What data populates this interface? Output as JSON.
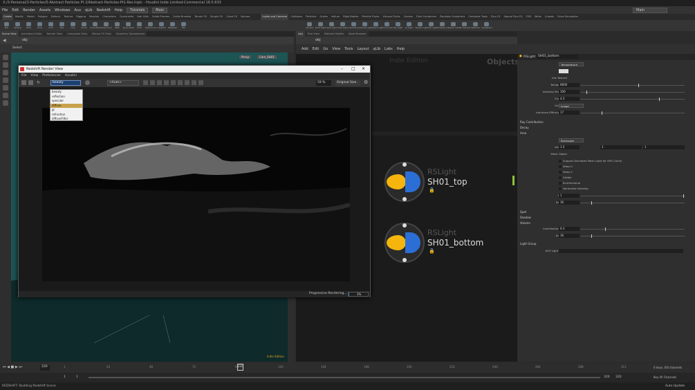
{
  "titlebar": "X:/3-Personal/3-Particles/5-Abstract Particles Pt 2/Abstract-Particles-Pt1-Res.hiplc - Houdini Indie Limited-Commercial 18.5.633",
  "menubar": {
    "items": [
      "File",
      "Edit",
      "Render",
      "Assets",
      "Windows",
      "Aux",
      "qLib",
      "Redshift",
      "Help"
    ],
    "desktop": "Tutorials",
    "context": "Main",
    "right_drop": "Main"
  },
  "shelf_tabs_left": [
    "Create",
    "Modify",
    "Model",
    "Polygon",
    "Deform",
    "Texture",
    "Rigging",
    "Muscles",
    "Characters",
    "Constraints",
    "Hair Utils",
    "Guide Process",
    "Guide Brushes",
    "Terrain FX",
    "Simple FX",
    "Cloud FX",
    "Volume"
  ],
  "shelf_tabs_right": [
    "Lights and Cameras",
    "Collisions",
    "Particles",
    "Grains",
    "Vellum",
    "Rigid Bodies",
    "Particle Fluids",
    "Viscous Fluids",
    "Oceans",
    "Fluid Containers",
    "Populate Containers",
    "Container Tools",
    "Pyro FX",
    "Sparse Pyro FX",
    "FEM",
    "Wires",
    "Crowds",
    "Drive Simulation"
  ],
  "shelf_tools_left": [
    "Box",
    "Sphere",
    "Tube",
    "Torus",
    "Grid",
    "Null",
    "Line",
    "Circle",
    "Curve Bezier",
    "Draw Curve",
    "Path",
    "Spray Paint",
    "Font",
    "Platonic Solids",
    "L-System",
    "Metaball",
    "File"
  ],
  "shelf_tools_right": [
    "Camera",
    "Point Light",
    "Spot Light",
    "Area Light",
    "Geometry Light",
    "Volume Light",
    "Distant Light",
    "Environment Light",
    "Sky Light",
    "GI Light",
    "Caustic Light",
    "Portal Light",
    "Ambient Light",
    "Stereo Camera",
    "VR Camera",
    "Switcher",
    "Gamepad Camera"
  ],
  "pane_tabs_left": [
    "Scene View",
    "Animation Editor",
    "Render View",
    "Composite View",
    "Motion FX View",
    "Geometry Spreadsheet"
  ],
  "pane_tabs_right": [
    "/obj",
    "Tree View",
    "Material Palette",
    "Asset Browser"
  ],
  "viewport": {
    "path": "obj",
    "mode": "Select",
    "persp": "Persp",
    "cam": "Cam_SH01",
    "badge": "Indie Edition"
  },
  "render_view": {
    "title": "Redshift Render View",
    "menu": [
      "File",
      "View",
      "Preferences",
      "Houdini"
    ],
    "aov_selected": "beauty",
    "aov_options": [
      "beauty",
      "reflection",
      "specular",
      "diffuse",
      "gi",
      "refraction",
      "diffuseFilter"
    ],
    "aov_highlight": "diffuse",
    "camera": "<Auto>",
    "zoom": "59 %",
    "size_mode": "Original Size",
    "progress_label": "Progressive Rendering...",
    "progress_value": "3%",
    "progress_fraction": 0.03
  },
  "network": {
    "menu": [
      "Add",
      "Edit",
      "Go",
      "View",
      "Tools",
      "Layout",
      "qLib",
      "Labs",
      "Help"
    ],
    "path": "obj",
    "context_label": "Indie Edition",
    "context_name": "Objects",
    "nodes": [
      {
        "type": "RSLight",
        "name": "SH01_top"
      },
      {
        "type": "RSLight",
        "name": "SH01_bottom"
      }
    ]
  },
  "params": {
    "node_type": "RSLight",
    "node_name": "SH01_bottom",
    "rows": [
      {
        "label": "Mode",
        "kind": "select",
        "value": "Temperature"
      },
      {
        "label": "Color",
        "kind": "color",
        "value": ""
      },
      {
        "label": "Use Texture",
        "kind": "text",
        "value": ""
      },
      {
        "label": "Temperature",
        "kind": "slider",
        "value": "6600",
        "fraction": 0.55
      },
      {
        "label": "Intensity Multiplier",
        "kind": "slider",
        "value": "100",
        "fraction": 0.05
      },
      {
        "label": "Exposure",
        "kind": "slider",
        "value": "4.3",
        "fraction": 0.75
      },
      {
        "label": "Unit Type",
        "kind": "select",
        "value": "Image"
      },
      {
        "label": "Luminous Efficacy (lm...",
        "kind": "slider",
        "value": "17",
        "fraction": 0.2
      }
    ],
    "sections1": [
      "Ray Contribution",
      "Decay",
      "Area"
    ],
    "area": {
      "shape_label": "Shape",
      "shape": "Rectangle",
      "size_label": "Area Size",
      "size": "1.5",
      "size_b": "1",
      "size_c": "1",
      "geo_label": "Mesh Object",
      "checks": [
        "Support Animated Mesh Light for GPU Cache",
        "Wrap U",
        "Wrap V",
        "Visible",
        "Bi-directional",
        "Normalize Intensity"
      ],
      "spread_label": "Spread",
      "spread": "1",
      "samples_label": "Samples",
      "samples": "16"
    },
    "sections2": [
      "Spot",
      "Shadow",
      "Volume"
    ],
    "volume": {
      "contrib_label": "Contribution Scale",
      "contrib": "0.3",
      "samples_label": "Samples",
      "samples": "16"
    },
    "light_group": "Light Group",
    "aov_group": "AOV Light Group"
  },
  "timeline": {
    "frame": "220",
    "start": "1",
    "start2": "1",
    "end": "320",
    "end2": "320",
    "ticks": [
      "1",
      "24",
      "48",
      "72",
      "96",
      "120",
      "144",
      "168",
      "192",
      "216",
      "240",
      "264",
      "288",
      "312"
    ],
    "keys_label": "0 keys, 0/0 channels",
    "key_all": "Key All Channels",
    "auto_update": "Auto Update"
  },
  "statusbar": "REDSHIFT: Building Redshift Scene",
  "colors": {
    "accent": "#f5b50c",
    "node_blue": "#2b6fd6",
    "viewport": "#1c4a4a",
    "lock": "#d44444"
  }
}
